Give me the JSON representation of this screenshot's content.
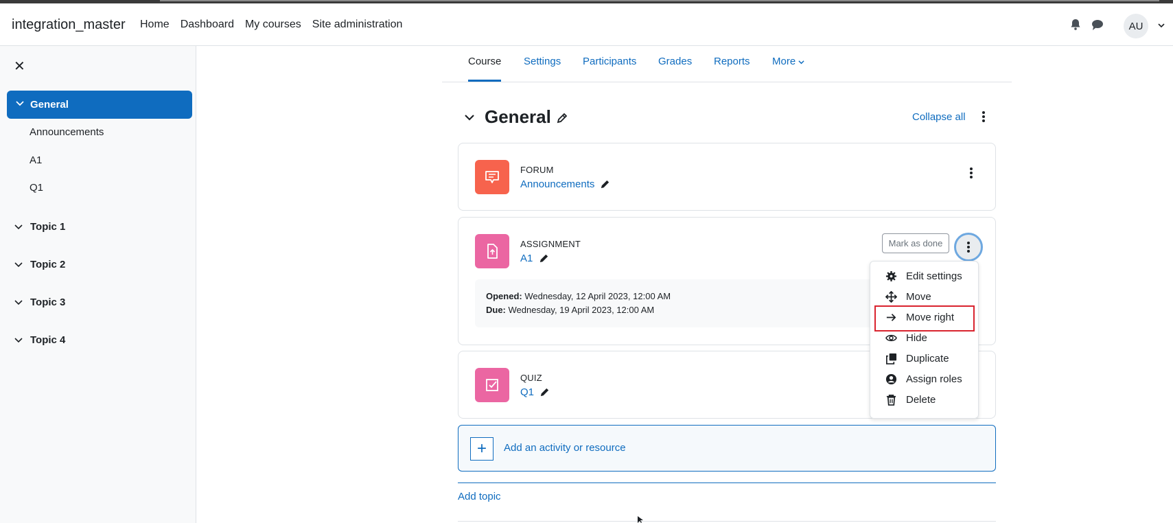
{
  "navbar": {
    "brand": "integration_master",
    "links": [
      "Home",
      "Dashboard",
      "My courses",
      "Site administration"
    ],
    "avatar_initials": "AU",
    "icons": [
      "bell-icon",
      "chat-icon",
      "chevron-down-icon"
    ]
  },
  "drawer": {
    "close_icon": "close-icon",
    "active_section": "General",
    "sub_items": [
      "Announcements",
      "A1",
      "Q1"
    ],
    "topics": [
      "Topic 1",
      "Topic 2",
      "Topic 3",
      "Topic 4"
    ]
  },
  "tabs": {
    "items": [
      "Course",
      "Settings",
      "Participants",
      "Grades",
      "Reports",
      "More"
    ],
    "active": "Course"
  },
  "section": {
    "title": "General",
    "collapse_all": "Collapse all"
  },
  "activities": [
    {
      "type": "FORUM",
      "name": "Announcements",
      "icon": "forum-icon",
      "color": "#f7634d"
    },
    {
      "type": "ASSIGNMENT",
      "name": "A1",
      "icon": "assignment-icon",
      "color": "#eb66a2",
      "mark_done": "Mark as done",
      "opened_label": "Opened:",
      "opened_value": " Wednesday, 12 April 2023, 12:00 AM",
      "due_label": "Due:",
      "due_value": " Wednesday, 19 April 2023, 12:00 AM"
    },
    {
      "type": "QUIZ",
      "name": "Q1",
      "icon": "quiz-icon",
      "color": "#eb66a2"
    }
  ],
  "dropdown": {
    "items": [
      {
        "label": "Edit settings",
        "icon": "gear-icon"
      },
      {
        "label": "Move",
        "icon": "move-icon"
      },
      {
        "label": "Move right",
        "icon": "arrow-right-icon"
      },
      {
        "label": "Hide",
        "icon": "eye-icon"
      },
      {
        "label": "Duplicate",
        "icon": "duplicate-icon"
      },
      {
        "label": "Assign roles",
        "icon": "user-circle-icon"
      },
      {
        "label": "Delete",
        "icon": "trash-icon"
      }
    ],
    "highlighted": "Move right"
  },
  "add_activity": {
    "label": "Add an activity or resource"
  },
  "add_topic": {
    "label": "Add topic"
  },
  "colors": {
    "primary": "#0f6cbf",
    "highlight": "#d9232e"
  }
}
